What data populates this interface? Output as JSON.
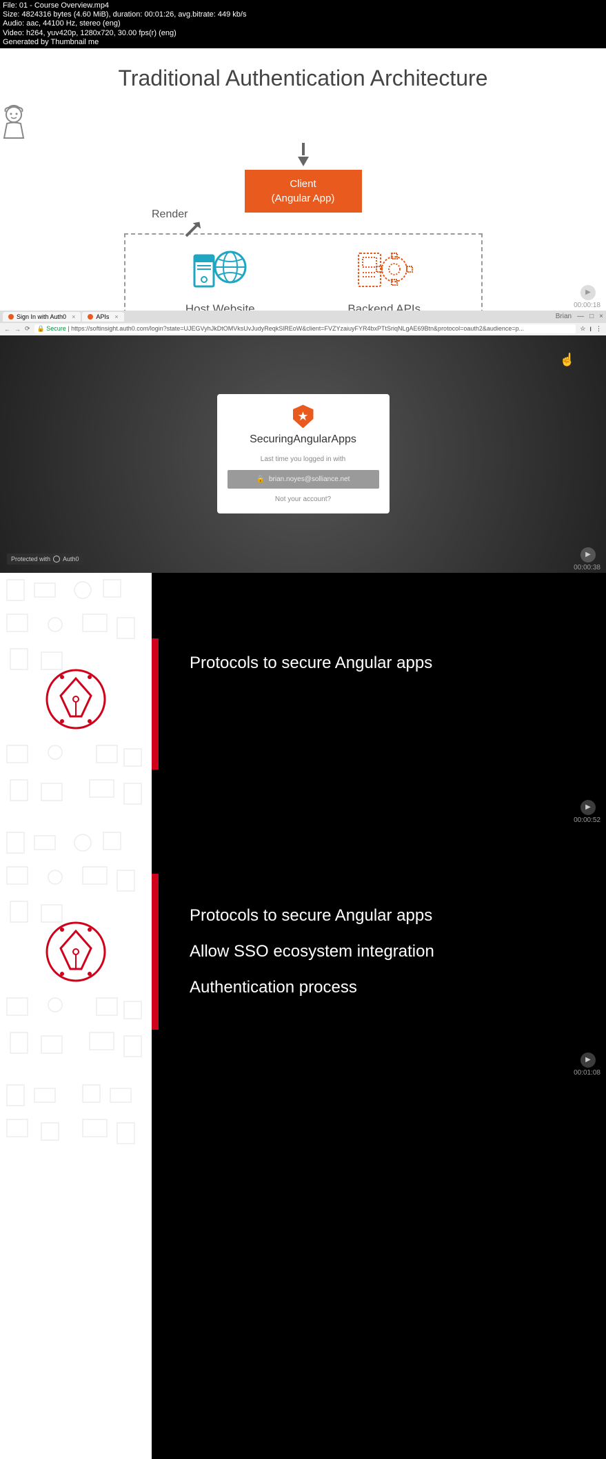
{
  "header": {
    "line1": "File: 01 - Course Overview.mp4",
    "line2": "Size: 4824316 bytes (4.60 MiB), duration: 00:01:26, avg.bitrate: 449 kb/s",
    "line3": "Audio: aac, 44100 Hz, stereo (eng)",
    "line4": "Video: h264, yuv420p, 1280x720, 30.00 fps(r) (eng)",
    "line5": "Generated by Thumbnail me"
  },
  "slide1": {
    "title": "Traditional Authentication Architecture",
    "client_line1": "Client",
    "client_line2": "(Angular App)",
    "render": "Render",
    "host": "Host Website",
    "backend": "Backend APIs",
    "timestamp": "00:00:18"
  },
  "slide2": {
    "tab1": "Sign In with Auth0",
    "tab2": "APIs",
    "user": "Brian",
    "secure": "Secure",
    "url": "https://softinsight.auth0.com/login?state=UJEGVyhJkDtOMVksUvJudyReqkSlREoW&client=FVZYzaiuyFYR4bxPTtSriqNLgAE69Btn&protocol=oauth2&audience=p...",
    "login_title": "SecuringAngularApps",
    "login_sub": "Last time you logged in with",
    "login_email": "brian.noyes@solliance.net",
    "login_not": "Not your account?",
    "protected": "Protected with",
    "auth0": "Auth0",
    "timestamp": "00:00:38"
  },
  "slide3": {
    "bullet1": "Protocols to secure Angular apps",
    "timestamp": "00:00:52"
  },
  "slide4": {
    "bullet1": "Protocols to secure Angular apps",
    "bullet2": "Allow SSO ecosystem integration",
    "bullet3": "Authentication process",
    "timestamp": "00:01:08"
  }
}
